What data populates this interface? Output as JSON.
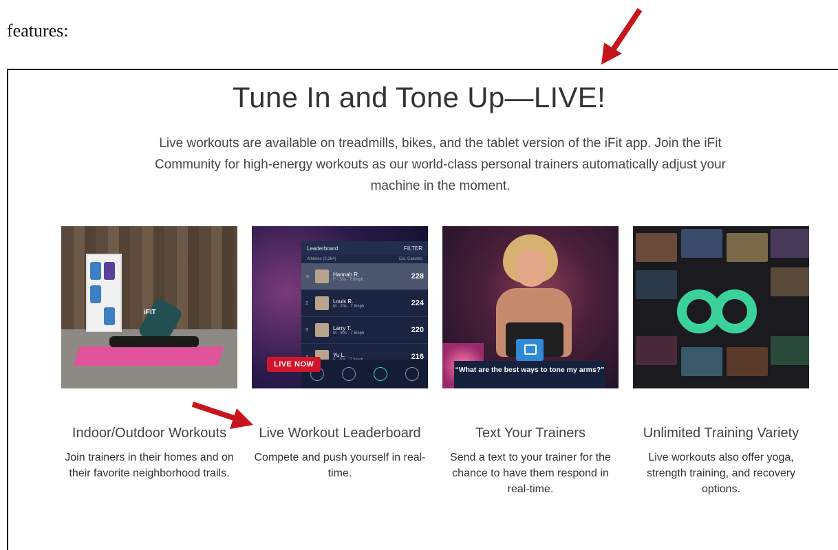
{
  "doc_label": "features:",
  "heading": "Tune In and Tone Up—LIVE!",
  "intro": "Live workouts are available on treadmills, bikes, and the tablet version of the iFit app. Join the iFit Community for high-energy workouts as our world-class personal trainers automatically adjust your machine in the moment.",
  "photo1": {
    "brand": "iFIT"
  },
  "leaderboard": {
    "title": "Leaderboard",
    "filter": "FILTER",
    "athletes": "Athletes (3,364)",
    "metric": "Est. Calories",
    "rows": [
      {
        "rank": "",
        "name": "Hannah R.",
        "info": "F · 20s · 7.6mph",
        "score": "228"
      },
      {
        "rank": "2",
        "name": "Louis R.",
        "info": "M · 20s · 7.8mph",
        "score": "224"
      },
      {
        "rank": "3",
        "name": "Larry T.",
        "info": "M · 30s · 7.5mph",
        "score": "220"
      },
      {
        "rank": "4",
        "name": "Yu L.",
        "info": "F · 40s · 7.2mph",
        "score": "216"
      }
    ],
    "live_badge": "LIVE NOW"
  },
  "chat_bubble": "“What are the best ways to tone my arms?”",
  "features": [
    {
      "title": "Indoor/Outdoor Workouts",
      "desc": "Join trainers in their homes and on their favorite neighborhood trails."
    },
    {
      "title": "Live Workout Leaderboard",
      "desc": "Compete and push yourself in real-time."
    },
    {
      "title": "Text Your Trainers",
      "desc": "Send a text to your trainer for the chance to have them respond in real-time."
    },
    {
      "title": "Unlimited Training Variety",
      "desc": "Live workouts also offer yoga, strength training, and recovery options."
    }
  ],
  "colors": {
    "arrow": "#c8141c",
    "infinity": "#3ad29a",
    "live_badge": "#d3152b"
  }
}
